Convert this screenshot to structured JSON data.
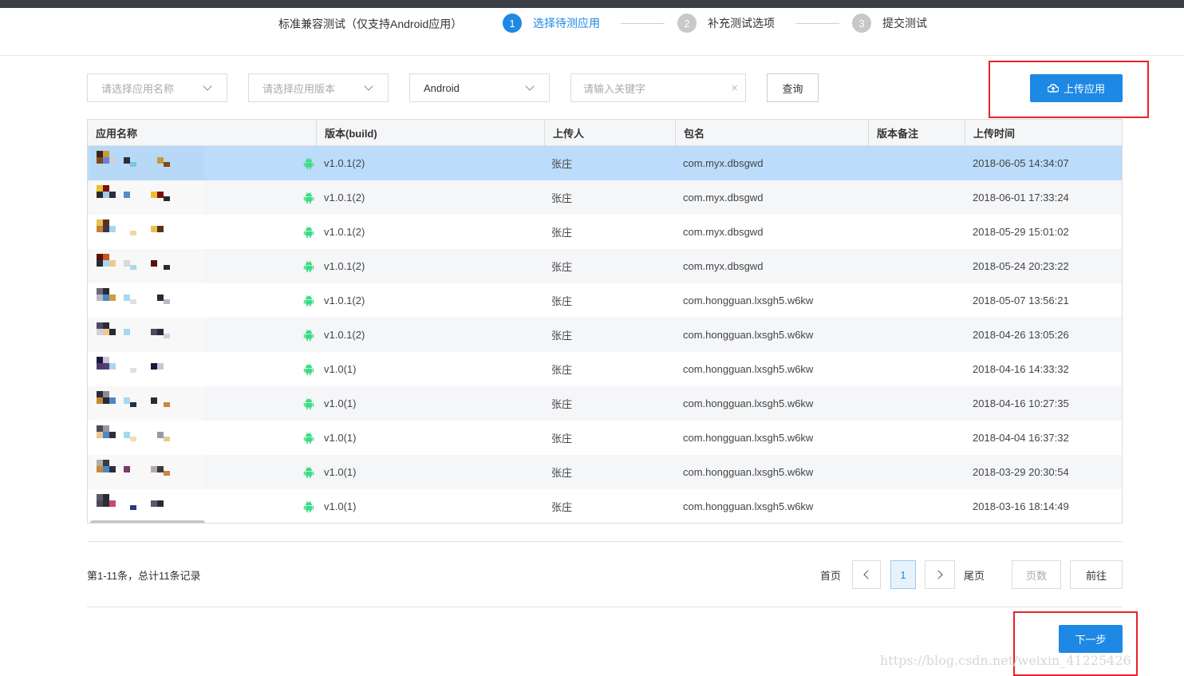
{
  "header": {
    "test_title": "标准兼容测试（仅支持Android应用）",
    "steps": [
      {
        "num": "1",
        "label": "选择待测应用"
      },
      {
        "num": "2",
        "label": "补充测试选项"
      },
      {
        "num": "3",
        "label": "提交测试"
      }
    ]
  },
  "filters": {
    "app_name_placeholder": "请选择应用名称",
    "app_version_placeholder": "请选择应用版本",
    "platform_value": "Android",
    "keyword_placeholder": "请输入关键字",
    "clear_icon": "×",
    "query_label": "查询",
    "upload_label": "上传应用"
  },
  "table": {
    "columns": [
      "应用名称",
      "版本(build)",
      "上传人",
      "包名",
      "版本备注",
      "上传时间"
    ],
    "rows": [
      {
        "version": "v1.0.1(2)",
        "uploader": "张庄",
        "package": "com.myx.dbsgwd",
        "note": "",
        "time": "2018-06-05 14:34:07"
      },
      {
        "version": "v1.0.1(2)",
        "uploader": "张庄",
        "package": "com.myx.dbsgwd",
        "note": "",
        "time": "2018-06-01 17:33:24"
      },
      {
        "version": "v1.0.1(2)",
        "uploader": "张庄",
        "package": "com.myx.dbsgwd",
        "note": "",
        "time": "2018-05-29 15:01:02"
      },
      {
        "version": "v1.0.1(2)",
        "uploader": "张庄",
        "package": "com.myx.dbsgwd",
        "note": "",
        "time": "2018-05-24 20:23:22"
      },
      {
        "version": "v1.0.1(2)",
        "uploader": "张庄",
        "package": "com.hongguan.lxsgh5.w6kw",
        "note": "",
        "time": "2018-05-07 13:56:21"
      },
      {
        "version": "v1.0.1(2)",
        "uploader": "张庄",
        "package": "com.hongguan.lxsgh5.w6kw",
        "note": "",
        "time": "2018-04-26 13:05:26"
      },
      {
        "version": "v1.0(1)",
        "uploader": "张庄",
        "package": "com.hongguan.lxsgh5.w6kw",
        "note": "",
        "time": "2018-04-16 14:33:32"
      },
      {
        "version": "v1.0(1)",
        "uploader": "张庄",
        "package": "com.hongguan.lxsgh5.w6kw",
        "note": "",
        "time": "2018-04-16 10:27:35"
      },
      {
        "version": "v1.0(1)",
        "uploader": "张庄",
        "package": "com.hongguan.lxsgh5.w6kw",
        "note": "",
        "time": "2018-04-04 16:37:32"
      },
      {
        "version": "v1.0(1)",
        "uploader": "张庄",
        "package": "com.hongguan.lxsgh5.w6kw",
        "note": "",
        "time": "2018-03-29 20:30:54"
      },
      {
        "version": "v1.0(1)",
        "uploader": "张庄",
        "package": "com.hongguan.lxsgh5.w6kw",
        "note": "",
        "time": "2018-03-16 18:14:49"
      }
    ],
    "selected_row": 0,
    "platform_icon": "android-icon"
  },
  "pagination": {
    "summary": "第1-11条，总计11条记录",
    "first_label": "首页",
    "current_page": "1",
    "last_label": "尾页",
    "page_placeholder": "页数",
    "go_label": "前往"
  },
  "footer": {
    "next_label": "下一步",
    "watermark": "https://blog.csdn.net/weixin_41225426"
  },
  "colors": {
    "primary": "#1e88e5",
    "highlight": "#e8222a",
    "selected_row": "#bcdcfb",
    "android_green": "#3ddc84"
  }
}
